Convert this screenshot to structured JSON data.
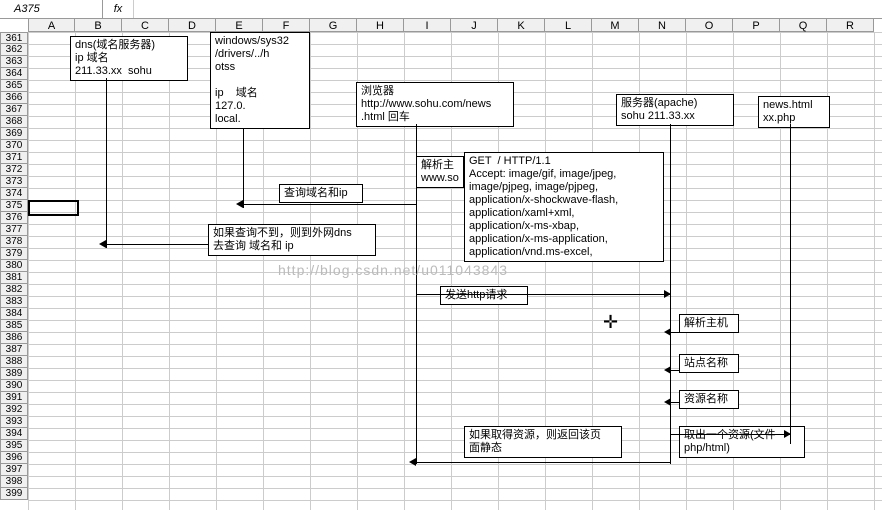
{
  "cellRef": "A375",
  "fx": "fx",
  "columns": [
    "A",
    "B",
    "C",
    "D",
    "E",
    "F",
    "G",
    "H",
    "I",
    "J",
    "K",
    "L",
    "M",
    "N",
    "O",
    "P",
    "Q",
    "R"
  ],
  "rowStart": 361,
  "rowEnd": 399,
  "boxes": {
    "dns": "dns(域名服务器)\nip 域名\n211.33.xx  sohu",
    "win": "windows/sys32\n/drivers/../h\notss\n\nip    域名\n127.0.\nlocal.",
    "browser": "浏览器\nhttp://www.sohu.com/news\n.html 回车",
    "server": "服务器(apache)\nsohu 211.33.xx",
    "files": "news.html\nxx.php",
    "parseHost": "解析主\nwww.so",
    "http": "GET  / HTTP/1.1\nAccept: image/gif, image/jpeg,\nimage/pjpeg, image/pjpeg,\napplication/x-shockwave-flash,\napplication/xaml+xml,\napplication/x-ms-xbap,\napplication/x-ms-application,\napplication/vnd.ms-excel,",
    "queryIp": "查询域名和ip",
    "notFound": "如果查询不到，则到外网dns\n去查询 域名和 ip",
    "sendReq": "发送http请求",
    "parseHost2": "解析主机",
    "siteName": "站点名称",
    "resName": "资源名称",
    "getRes": "取出一个资源(文件\nphp/html)",
    "ifGot": "如果取得资源，则返回该页\n面静态"
  },
  "watermark": "http://blog.csdn.net/u011043843",
  "cursor": "✛"
}
